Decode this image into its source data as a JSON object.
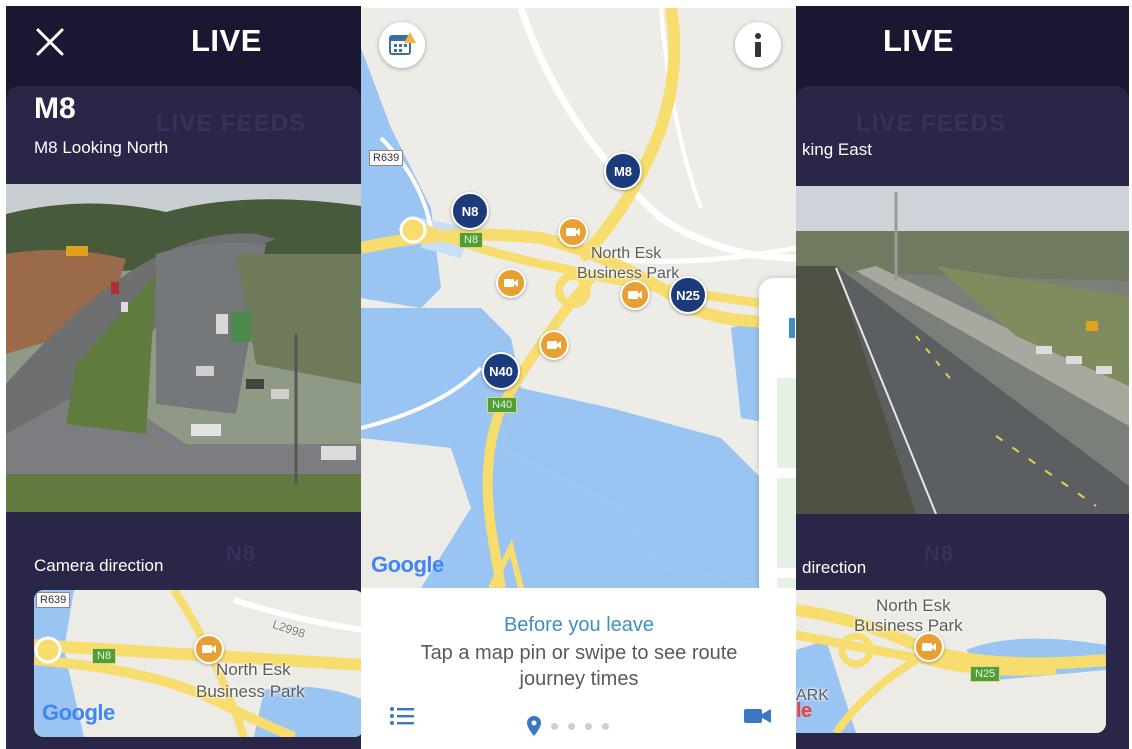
{
  "left_screen": {
    "close_icon": "close-icon",
    "title": "LIVE",
    "tab_ghost": "LIVE FEEDS",
    "camera_code": "M8",
    "camera_name": "M8 Looking North",
    "direction_label": "Camera direction",
    "lower_ghost": "N8",
    "mini_map": {
      "road_ref": "R639",
      "shield": "N8",
      "road_label": "L2998",
      "place_line1": "North Esk",
      "place_line2": "Business Park",
      "google": "Google"
    }
  },
  "center_screen": {
    "map": {
      "road_ref": "R639",
      "pins": [
        "M8",
        "N8",
        "N25",
        "N40"
      ],
      "shields": [
        "N8",
        "N40"
      ],
      "place_line1": "North Esk",
      "place_line2": "Business Park",
      "google": "Google"
    },
    "top_left_icon": "calendar-alert-icon",
    "top_right_icon": "info-icon",
    "sheet": {
      "title": "Before you leave",
      "body": "Tap a map pin or swipe to see route journey times"
    },
    "bottom_icons": {
      "left": "list-icon",
      "right": "video-camera-icon",
      "pager_active": "location-pin-icon"
    },
    "pager_count": 5
  },
  "right_screen": {
    "title": "LIVE",
    "tab_ghost": "LIVE FEEDS",
    "camera_name_partial": "king East",
    "direction_label_partial": "direction",
    "lower_ghost": "N8",
    "mini_map": {
      "place_line1": "North Esk",
      "place_line2": "Business Park",
      "shield": "N25",
      "partial_text": "ARK",
      "partial_google": "le"
    }
  },
  "colors": {
    "navy": "#1b1733",
    "card": "#2a2648",
    "pin_blue": "#1c3b7a",
    "camera_orange": "#e8a033",
    "water": "#9ac4f2",
    "road_yellow": "#f7dc6e",
    "link_blue": "#3f8fc0"
  }
}
